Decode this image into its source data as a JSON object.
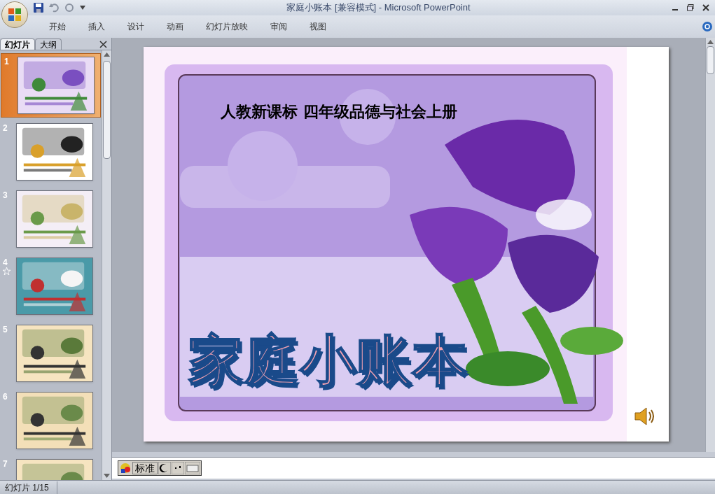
{
  "window": {
    "title": "家庭小账本 [兼容模式] - Microsoft PowerPoint"
  },
  "ribbon_tabs": [
    {
      "label": "开始",
      "selected": false
    },
    {
      "label": "插入",
      "selected": false
    },
    {
      "label": "设计",
      "selected": false
    },
    {
      "label": "动画",
      "selected": false
    },
    {
      "label": "幻灯片放映",
      "selected": false
    },
    {
      "label": "审阅",
      "selected": false
    },
    {
      "label": "视图",
      "selected": false
    }
  ],
  "panel_tabs": [
    {
      "label": "幻灯片",
      "selected": true
    },
    {
      "label": "大纲",
      "selected": false
    }
  ],
  "slides": [
    {
      "number": "1",
      "selected": true,
      "animated": false
    },
    {
      "number": "2",
      "selected": false,
      "animated": false
    },
    {
      "number": "3",
      "selected": false,
      "animated": false
    },
    {
      "number": "4",
      "selected": false,
      "animated": true
    },
    {
      "number": "5",
      "selected": false,
      "animated": false
    },
    {
      "number": "6",
      "selected": false,
      "animated": false
    },
    {
      "number": "7",
      "selected": false,
      "animated": false
    }
  ],
  "slide": {
    "subtitle": "人教新课标 四年级品德与社会上册",
    "title": "家庭小账本"
  },
  "ime_toolbar": {
    "mode": "标准"
  },
  "status_bar": {
    "slide_counter": "幻灯片 1/15"
  }
}
